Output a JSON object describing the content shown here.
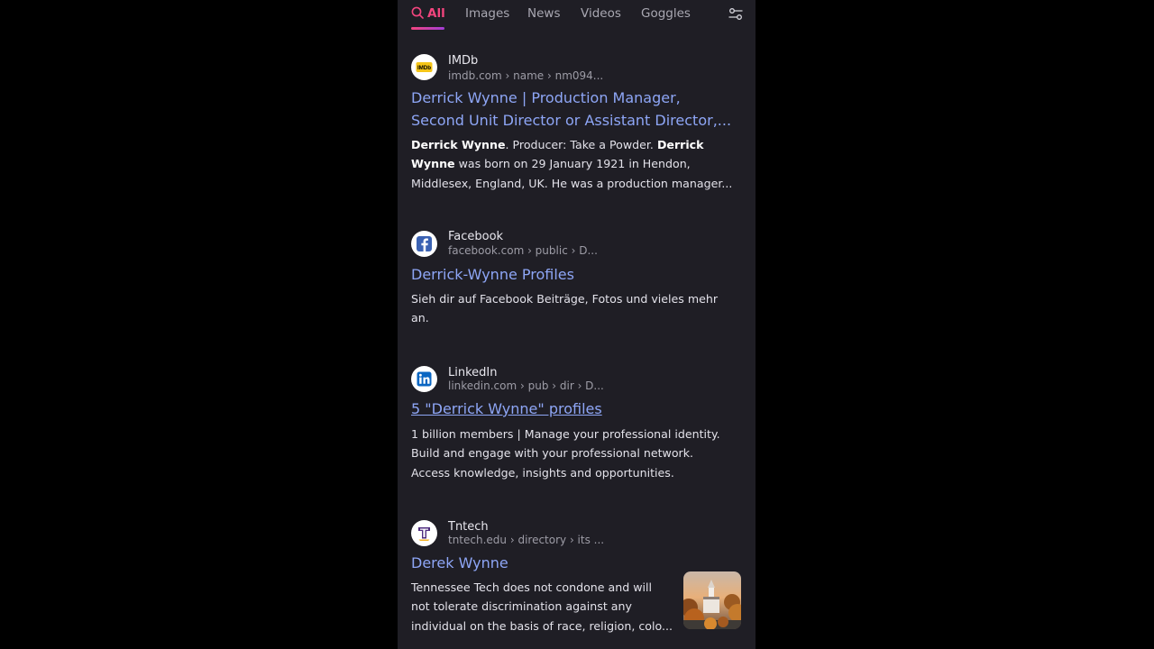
{
  "tabs": {
    "all": "All",
    "images": "Images",
    "news": "News",
    "videos": "Videos",
    "goggles": "Goggles"
  },
  "colors": {
    "accent": "#f3457e",
    "link": "#8ea6f6",
    "background": "#1f1e25"
  },
  "results": [
    {
      "site": "IMDb",
      "crumb": "imdb.com › name › nm094...",
      "icon": "imdb-icon",
      "title_line1": "Derrick Wynne | Production Manager,",
      "title_line2": "Second Unit Director or Assistant Director,...",
      "s1a": "Derrick Wynne",
      "s1b": ". Producer: Take a Powder. ",
      "s1c": "Derrick",
      "s2a": "Wynne",
      "s2b": " was born on 29 January 1921 in Hendon,",
      "s3": "Middlesex, England, UK. He was a production manager..."
    },
    {
      "site": "Facebook",
      "crumb": "facebook.com › public › D...",
      "icon": "facebook-icon",
      "title": "Derrick-Wynne Profiles",
      "line1": "Sieh dir auf Facebook Beiträge, Fotos und vieles mehr",
      "line2": "an."
    },
    {
      "site": "LinkedIn",
      "crumb": "linkedin.com › pub › dir › D...",
      "icon": "linkedin-icon",
      "title": "5 \"Derrick Wynne\" profiles",
      "line1": "1 billion members | Manage your professional identity.",
      "line2": "Build and engage with your professional network.",
      "line3": "Access knowledge, insights and opportunities."
    },
    {
      "site": "Tntech",
      "crumb": "tntech.edu › directory › its ...",
      "icon": "tntech-icon",
      "title": "Derek Wynne",
      "line1": "Tennessee Tech does not condone and will",
      "line2": "not tolerate discrimination against any",
      "line3": "individual on the basis of race, religion, colo..."
    }
  ]
}
